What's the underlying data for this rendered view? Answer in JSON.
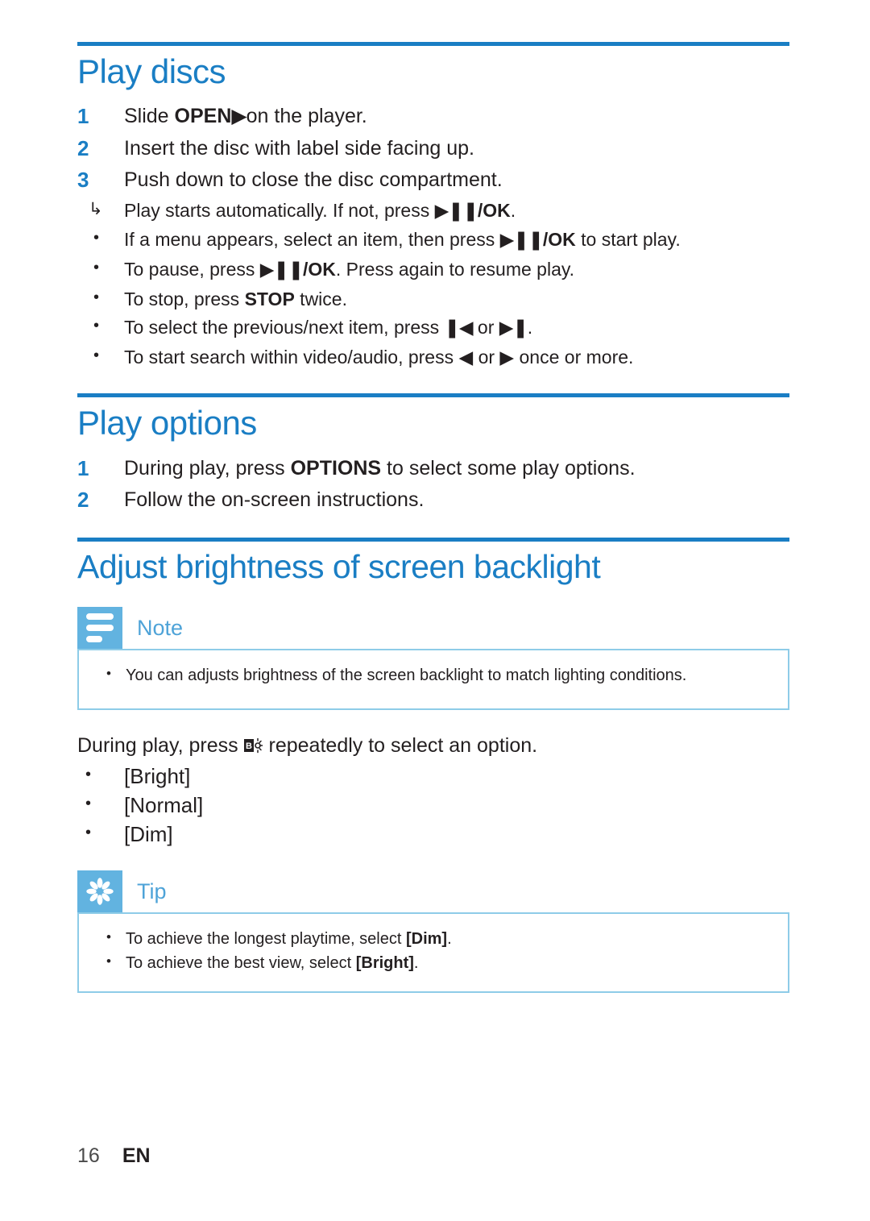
{
  "page": {
    "footer_page_number": "16",
    "footer_language": "EN"
  },
  "colors": {
    "heading_blue": "#1A7EC4",
    "rule_blue": "#1A7EC4",
    "callout_icon_blue": "#62B3E0",
    "callout_border_blue": "#8ECCE8",
    "callout_label_blue": "#4EA3D8",
    "body_text": "#231F20"
  },
  "sections": [
    {
      "id": "play-discs",
      "title": "Play discs",
      "steps": [
        {
          "num": "1",
          "parts": [
            {
              "t": "Slide ",
              "style": "normal"
            },
            {
              "t": "OPEN",
              "style": "bold"
            },
            {
              "t": "▶",
              "style": "glyph"
            },
            {
              "t": "on the player.",
              "style": "normal"
            }
          ]
        },
        {
          "num": "2",
          "parts": [
            {
              "t": "Insert the disc with label side facing up.",
              "style": "normal"
            }
          ]
        },
        {
          "num": "3",
          "parts": [
            {
              "t": "Push down to close the disc compartment.",
              "style": "normal"
            }
          ]
        }
      ],
      "subitems": [
        {
          "mark": "↳",
          "mark_kind": "arrow",
          "indent": false,
          "parts": [
            {
              "t": "Play starts automatically. If not, press ",
              "style": "normal"
            },
            {
              "t": "▶❙❙",
              "style": "glyph"
            },
            {
              "t": "/OK",
              "style": "bold"
            },
            {
              "t": ".",
              "style": "normal"
            }
          ]
        },
        {
          "mark": "•",
          "mark_kind": "dot",
          "indent": false,
          "parts": [
            {
              "t": "If a menu appears, select an item, then press ",
              "style": "normal"
            },
            {
              "t": "▶❙❙",
              "style": "glyph"
            },
            {
              "t": "/OK",
              "style": "bold"
            },
            {
              "t": " to start play.",
              "style": "normal"
            }
          ]
        },
        {
          "mark": "•",
          "mark_kind": "dot",
          "indent": false,
          "parts": [
            {
              "t": "To pause, press ",
              "style": "normal"
            },
            {
              "t": "▶❙❙",
              "style": "glyph"
            },
            {
              "t": "/OK",
              "style": "bold"
            },
            {
              "t": ". Press again to resume play.",
              "style": "normal"
            }
          ]
        },
        {
          "mark": "•",
          "mark_kind": "dot",
          "indent": false,
          "parts": [
            {
              "t": "To stop, press ",
              "style": "normal"
            },
            {
              "t": "STOP",
              "style": "bold"
            },
            {
              "t": " twice.",
              "style": "normal"
            }
          ]
        },
        {
          "mark": "•",
          "mark_kind": "dot",
          "indent": false,
          "parts": [
            {
              "t": "To select the previous/next item, press ",
              "style": "normal"
            },
            {
              "t": "❙◀",
              "style": "glyph"
            },
            {
              "t": " or ",
              "style": "normal"
            },
            {
              "t": "▶❙",
              "style": "glyph"
            },
            {
              "t": ".",
              "style": "normal"
            }
          ]
        },
        {
          "mark": "•",
          "mark_kind": "dot",
          "indent": false,
          "parts": [
            {
              "t": "To start search within video/audio, press ",
              "style": "normal"
            },
            {
              "t": "◀",
              "style": "glyph-thin"
            },
            {
              "t": " or ",
              "style": "normal"
            },
            {
              "t": "▶",
              "style": "glyph-thin"
            },
            {
              "t": " once or more.",
              "style": "normal"
            }
          ]
        }
      ]
    },
    {
      "id": "play-options",
      "title": "Play options",
      "steps": [
        {
          "num": "1",
          "parts": [
            {
              "t": "During play, press ",
              "style": "normal"
            },
            {
              "t": "OPTIONS",
              "style": "bold"
            },
            {
              "t": " to select some play options.",
              "style": "normal"
            }
          ]
        },
        {
          "num": "2",
          "parts": [
            {
              "t": "Follow the on-screen instructions.",
              "style": "normal"
            }
          ]
        }
      ],
      "subitems": []
    },
    {
      "id": "adjust-brightness",
      "title": "Adjust brightness of screen backlight",
      "steps": [],
      "subitems": []
    }
  ],
  "note_callout": {
    "icon_name": "note-lines-icon",
    "label": "Note",
    "items": [
      {
        "bullet": "•",
        "text": "You can adjusts brightness of the screen backlight to match lighting conditions."
      }
    ]
  },
  "tip_callout": {
    "icon_name": "tip-asterisk-icon",
    "label": "Tip",
    "items": [
      {
        "bullet": "•",
        "parts": [
          {
            "t": "To achieve the longest playtime, select ",
            "style": "normal"
          },
          {
            "t": "[Dim]",
            "style": "bold"
          },
          {
            "t": ".",
            "style": "normal"
          }
        ]
      },
      {
        "bullet": "•",
        "parts": [
          {
            "t": "To achieve the best view, select ",
            "style": "normal"
          },
          {
            "t": "[Bright]",
            "style": "bold"
          },
          {
            "t": ".",
            "style": "normal"
          }
        ]
      }
    ]
  },
  "brightness": {
    "lead_before_icon": "During play, press ",
    "icon_name": "brightness-backlight-icon",
    "lead_after_icon": " repeatedly to select an option.",
    "options": [
      {
        "bullet": "•",
        "label": "[Bright]"
      },
      {
        "bullet": "•",
        "label": "[Normal]"
      },
      {
        "bullet": "•",
        "label": "[Dim]"
      }
    ]
  }
}
